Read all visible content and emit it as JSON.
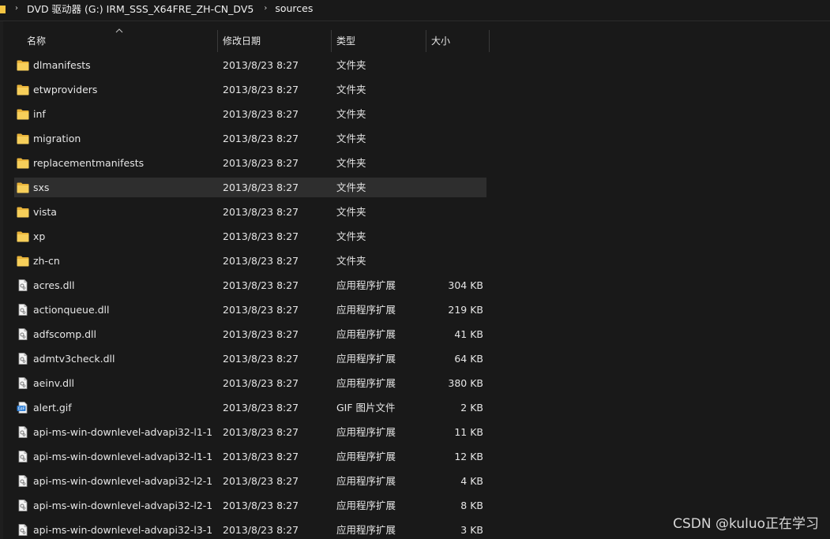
{
  "breadcrumb": {
    "items": [
      "DVD 驱动器 (G:) IRM_SSS_X64FRE_ZH-CN_DV5",
      "sources"
    ],
    "separator": "›"
  },
  "columns": {
    "name": "名称",
    "date": "修改日期",
    "type": "类型",
    "size": "大小"
  },
  "files": [
    {
      "name": "dlmanifests",
      "date": "2013/8/23 8:27",
      "type": "文件夹",
      "size": "",
      "icon": "folder-icon",
      "selected": false
    },
    {
      "name": "etwproviders",
      "date": "2013/8/23 8:27",
      "type": "文件夹",
      "size": "",
      "icon": "folder-icon",
      "selected": false
    },
    {
      "name": "inf",
      "date": "2013/8/23 8:27",
      "type": "文件夹",
      "size": "",
      "icon": "folder-icon",
      "selected": false
    },
    {
      "name": "migration",
      "date": "2013/8/23 8:27",
      "type": "文件夹",
      "size": "",
      "icon": "folder-icon",
      "selected": false
    },
    {
      "name": "replacementmanifests",
      "date": "2013/8/23 8:27",
      "type": "文件夹",
      "size": "",
      "icon": "folder-icon",
      "selected": false
    },
    {
      "name": "sxs",
      "date": "2013/8/23 8:27",
      "type": "文件夹",
      "size": "",
      "icon": "folder-icon",
      "selected": true
    },
    {
      "name": "vista",
      "date": "2013/8/23 8:27",
      "type": "文件夹",
      "size": "",
      "icon": "folder-icon",
      "selected": false
    },
    {
      "name": "xp",
      "date": "2013/8/23 8:27",
      "type": "文件夹",
      "size": "",
      "icon": "folder-icon",
      "selected": false
    },
    {
      "name": "zh-cn",
      "date": "2013/8/23 8:27",
      "type": "文件夹",
      "size": "",
      "icon": "folder-icon",
      "selected": false
    },
    {
      "name": "acres.dll",
      "date": "2013/8/23 8:27",
      "type": "应用程序扩展",
      "size": "304 KB",
      "icon": "dll-file-icon",
      "selected": false
    },
    {
      "name": "actionqueue.dll",
      "date": "2013/8/23 8:27",
      "type": "应用程序扩展",
      "size": "219 KB",
      "icon": "dll-file-icon",
      "selected": false
    },
    {
      "name": "adfscomp.dll",
      "date": "2013/8/23 8:27",
      "type": "应用程序扩展",
      "size": "41 KB",
      "icon": "dll-file-icon",
      "selected": false
    },
    {
      "name": "admtv3check.dll",
      "date": "2013/8/23 8:27",
      "type": "应用程序扩展",
      "size": "64 KB",
      "icon": "dll-file-icon",
      "selected": false
    },
    {
      "name": "aeinv.dll",
      "date": "2013/8/23 8:27",
      "type": "应用程序扩展",
      "size": "380 KB",
      "icon": "dll-file-icon",
      "selected": false
    },
    {
      "name": "alert.gif",
      "date": "2013/8/23 8:27",
      "type": "GIF 图片文件",
      "size": "2 KB",
      "icon": "gif-file-icon",
      "selected": false
    },
    {
      "name": "api-ms-win-downlevel-advapi32-l1-1-...",
      "date": "2013/8/23 8:27",
      "type": "应用程序扩展",
      "size": "11 KB",
      "icon": "dll-file-icon",
      "selected": false
    },
    {
      "name": "api-ms-win-downlevel-advapi32-l1-1-...",
      "date": "2013/8/23 8:27",
      "type": "应用程序扩展",
      "size": "12 KB",
      "icon": "dll-file-icon",
      "selected": false
    },
    {
      "name": "api-ms-win-downlevel-advapi32-l2-1-...",
      "date": "2013/8/23 8:27",
      "type": "应用程序扩展",
      "size": "4 KB",
      "icon": "dll-file-icon",
      "selected": false
    },
    {
      "name": "api-ms-win-downlevel-advapi32-l2-1-...",
      "date": "2013/8/23 8:27",
      "type": "应用程序扩展",
      "size": "8 KB",
      "icon": "dll-file-icon",
      "selected": false
    },
    {
      "name": "api-ms-win-downlevel-advapi32-l3-1-...",
      "date": "2013/8/23 8:27",
      "type": "应用程序扩展",
      "size": "3 KB",
      "icon": "dll-file-icon",
      "selected": false
    }
  ],
  "watermark": "CSDN @kuluo正在学习",
  "colors": {
    "background": "#191919",
    "selected_row": "#2e2e2e",
    "folder": "#f5c542",
    "text": "#e6e6e6"
  }
}
